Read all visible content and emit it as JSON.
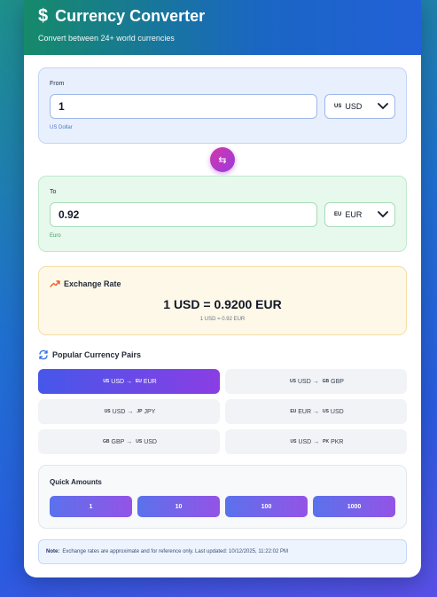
{
  "header": {
    "icon": "dollar-icon",
    "title": "Currency Converter",
    "subtitle": "Convert between 24+ world currencies"
  },
  "from": {
    "label": "From",
    "amount": "1",
    "currency_flag": "US",
    "currency_code": "USD",
    "currency_name": "US Dollar"
  },
  "swap": {
    "icon": "swap-icon",
    "glyph": "⇆"
  },
  "to": {
    "label": "To",
    "amount": "0.92",
    "currency_flag": "EU",
    "currency_code": "EUR",
    "currency_name": "Euro"
  },
  "rate": {
    "heading": "Exchange Rate",
    "main": "1 USD = 0.9200 EUR",
    "sub": "1 USD = 0.92 EUR"
  },
  "popular": {
    "heading": "Popular Currency Pairs",
    "pairs": [
      {
        "from_flag": "US",
        "from": "USD",
        "to_flag": "EU",
        "to": "EUR",
        "active": true
      },
      {
        "from_flag": "US",
        "from": "USD",
        "to_flag": "GB",
        "to": "GBP",
        "active": false
      },
      {
        "from_flag": "US",
        "from": "USD",
        "to_flag": "JP",
        "to": "JPY",
        "active": false
      },
      {
        "from_flag": "EU",
        "from": "EUR",
        "to_flag": "US",
        "to": "USD",
        "active": false
      },
      {
        "from_flag": "GB",
        "from": "GBP",
        "to_flag": "US",
        "to": "USD",
        "active": false
      },
      {
        "from_flag": "US",
        "from": "USD",
        "to_flag": "PK",
        "to": "PKR",
        "active": false
      }
    ],
    "arrow": "→"
  },
  "quick": {
    "heading": "Quick Amounts",
    "amounts": [
      "1",
      "10",
      "100",
      "1000"
    ]
  },
  "note": {
    "label": "Note:",
    "text": "Exchange rates are approximate and for reference only. Last updated: 10/12/2025, 11:22:02 PM"
  },
  "colors": {
    "accent_start": "#4657ea",
    "accent_end": "#8a3ee4",
    "swap": "#d336a8",
    "trend": "#e8622c",
    "refresh": "#2f6fe0"
  }
}
